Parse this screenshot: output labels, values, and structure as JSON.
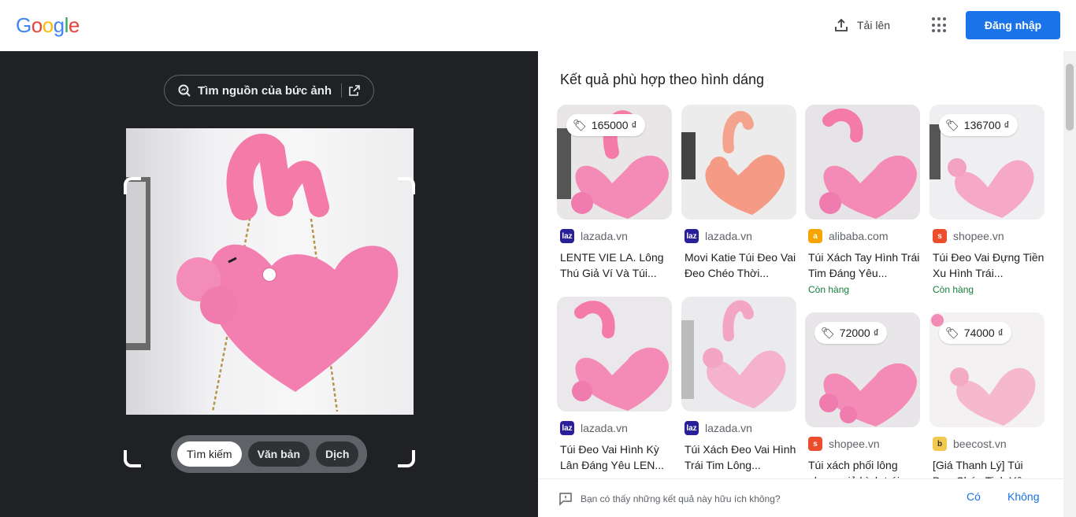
{
  "header": {
    "logo_letters": [
      "G",
      "o",
      "o",
      "g",
      "l",
      "e"
    ],
    "logo_colors": [
      "#4285f4",
      "#ea4335",
      "#fbbc05",
      "#4285f4",
      "#34a853",
      "#ea4335"
    ],
    "upload_label": "Tải lên",
    "signin_label": "Đăng nhập"
  },
  "viewer": {
    "find_source_label": "Tìm nguồn của bức ảnh",
    "modes": [
      "Tìm kiếm",
      "Văn bản",
      "Dịch"
    ],
    "active_mode": "Tìm kiếm"
  },
  "results": {
    "title": "Kết quả phù hợp theo hình dáng",
    "items": [
      {
        "price": "165000 ₫",
        "source": "lazada.vn",
        "title": "LENTE VIE LA. Lông Thú Giả Ví Và Túi...",
        "stock": "",
        "fav": "lazada"
      },
      {
        "price": "",
        "source": "lazada.vn",
        "title": "Movi Katie Túi Đeo Vai Đeo Chéo Thời...",
        "stock": "",
        "fav": "lazada"
      },
      {
        "price": "",
        "source": "alibaba.com",
        "title": "Túi Xách Tay Hình Trái Tim Đáng Yêu...",
        "stock": "Còn hàng",
        "fav": "alibaba"
      },
      {
        "price": "136700 ₫",
        "source": "shopee.vn",
        "title": "Túi Đeo Vai Đựng Tiền Xu Hình Trái...",
        "stock": "Còn hàng",
        "fav": "shopee"
      },
      {
        "price": "",
        "source": "lazada.vn",
        "title": "Túi Đeo Vai Hình Kỳ Lân Đáng Yêu LEN...",
        "stock": "",
        "fav": "lazada"
      },
      {
        "price": "",
        "source": "lazada.vn",
        "title": "Túi Xách Đeo Vai Hình Trái Tim Lông...",
        "stock": "",
        "fav": "lazada"
      },
      {
        "price": "72000 ₫",
        "source": "shopee.vn",
        "title": "Túi xách phối lông nhung giả hình trái...",
        "stock": "",
        "fav": "shopee"
      },
      {
        "price": "74000 ₫",
        "source": "beecost.vn",
        "title": "[Giá Thanh Lý] Túi Đeo Chéo Tinh Yêu...",
        "stock": "",
        "fav": "beecost"
      }
    ]
  },
  "feedback": {
    "question": "Bạn có thấy những kết quả này hữu ích không?",
    "yes": "Có",
    "no": "Không"
  },
  "colors": {
    "accent": "#1a73e8",
    "dark_bg": "#202124",
    "in_stock": "#188038"
  }
}
